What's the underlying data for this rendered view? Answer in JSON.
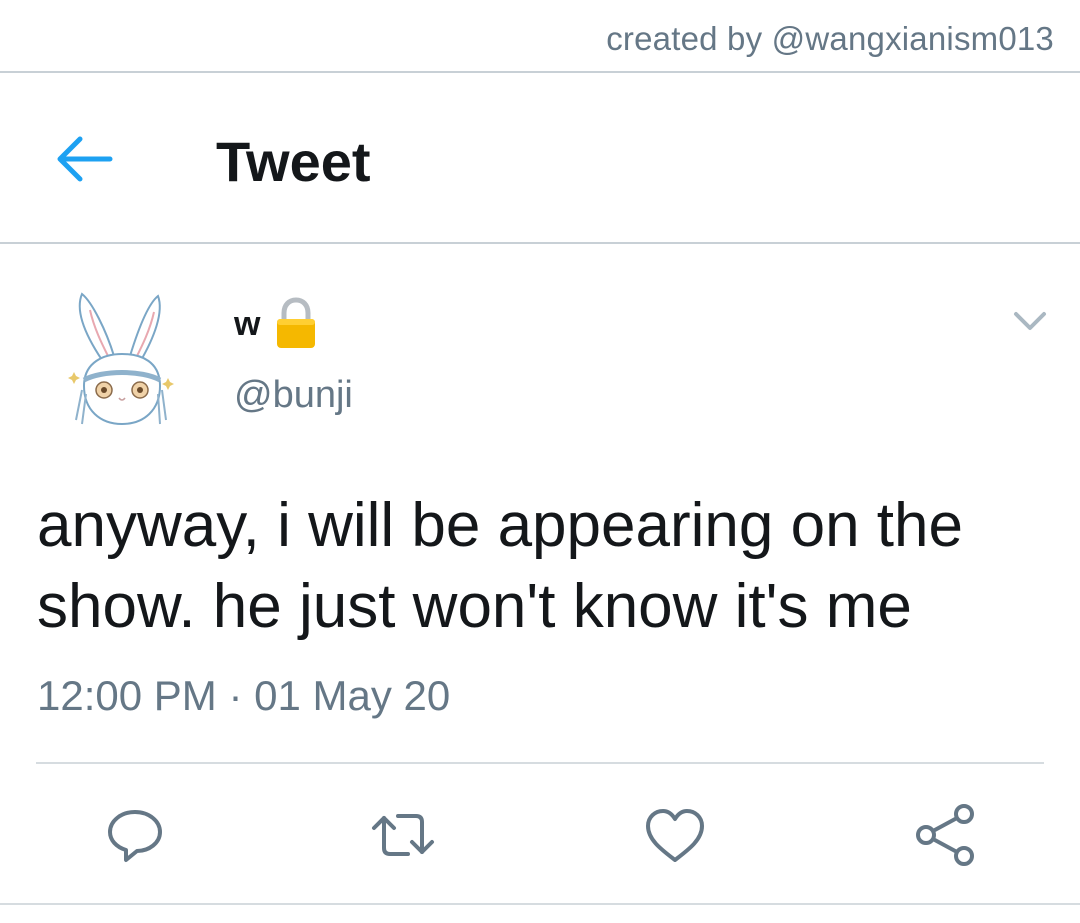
{
  "watermark": {
    "credit": "created by @wangxianism013"
  },
  "header": {
    "title": "Tweet",
    "back_icon": "arrow-left-icon"
  },
  "tweet": {
    "author": {
      "display_name": "w",
      "handle": "@bunji",
      "protected_icon": "lock-icon",
      "avatar": "bunny-avatar"
    },
    "text_line1": "anyway, i will be appearing on the",
    "text_line2": "show. he just won't know it's me",
    "time": "12:00 PM",
    "separator": "·",
    "date": "01 May 20",
    "menu_icon": "chevron-down-icon"
  },
  "actions": [
    {
      "name": "reply",
      "icon": "reply-icon"
    },
    {
      "name": "retweet",
      "icon": "retweet-icon"
    },
    {
      "name": "like",
      "icon": "heart-icon"
    },
    {
      "name": "share",
      "icon": "share-icon"
    }
  ],
  "colors": {
    "accent": "#1da1f2",
    "text": "#14171a",
    "secondary": "#657786",
    "lock": "#f5b800",
    "divider": "#c8d0d6"
  }
}
